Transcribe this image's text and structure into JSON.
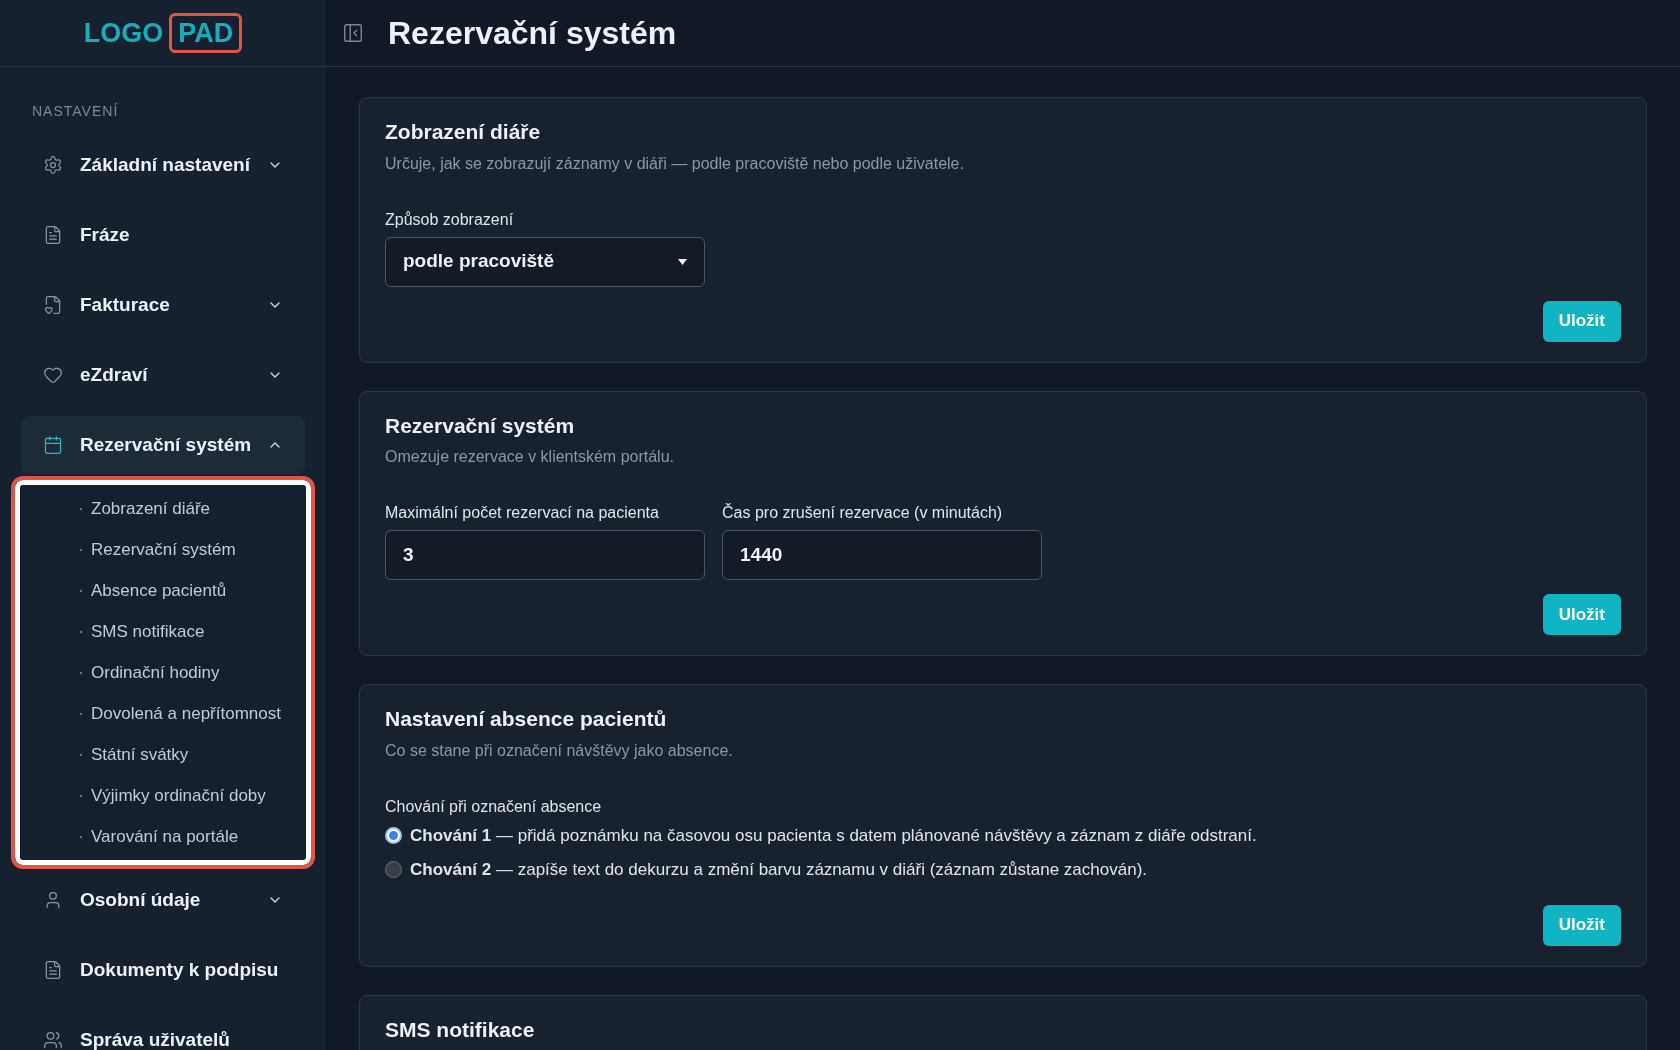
{
  "logo": {
    "word": "LOGO",
    "highlighted_word": "PAD"
  },
  "sidebar": {
    "section_title": "NASTAVENÍ",
    "items": [
      {
        "label": "Základní nastavení",
        "expandable": true,
        "expanded": false,
        "selected": false
      },
      {
        "label": "Fráze",
        "expandable": false,
        "selected": false
      },
      {
        "label": "Fakturace",
        "expandable": true,
        "expanded": false,
        "selected": false
      },
      {
        "label": "eZdraví",
        "expandable": true,
        "expanded": false,
        "selected": false
      },
      {
        "label": "Rezervační systém",
        "expandable": true,
        "expanded": true,
        "selected": true,
        "children": [
          {
            "label": "Zobrazení diáře"
          },
          {
            "label": "Rezervační systém"
          },
          {
            "label": "Absence pacientů"
          },
          {
            "label": "SMS notifikace"
          },
          {
            "label": "Ordinační hodiny"
          },
          {
            "label": "Dovolená a nepřítomnost"
          },
          {
            "label": "Státní svátky"
          },
          {
            "label": "Výjimky ordinační doby"
          },
          {
            "label": "Varování na portále"
          }
        ]
      },
      {
        "label": "Osobní údaje",
        "expandable": true,
        "expanded": false,
        "selected": false
      },
      {
        "label": "Dokumenty k podpisu",
        "expandable": false,
        "selected": false
      },
      {
        "label": "Správa uživatelů",
        "expandable": false,
        "selected": false
      }
    ]
  },
  "page_title": "Rezervační systém",
  "cards": [
    {
      "title": "Zobrazení diáře",
      "description": "Určuje, jak se zobrazují záznamy v diáři — podle pracoviště nebo podle uživatele.",
      "fields": [
        {
          "kind": "select",
          "label": "Způsob zobrazení",
          "value": "podle pracoviště"
        }
      ],
      "button": "Uložit"
    },
    {
      "title": "Rezervační systém",
      "description": "Omezuje rezervace v klientském portálu.",
      "fields": [
        {
          "kind": "input",
          "label": "Maximální počet rezervací na pacienta",
          "value": "3"
        },
        {
          "kind": "input",
          "label": "Čas pro zrušení rezervace (v minutách)",
          "value": "1440"
        }
      ],
      "button": "Uložit"
    },
    {
      "title": "Nastavení absence pacientů",
      "description": "Co se stane při označení návštěvy jako absence.",
      "fields": [
        {
          "kind": "radio",
          "label": "Chování při označení absence",
          "options": [
            {
              "text": "**Chování 1** — přidá poznámku na časovou osu pacienta s datem plánované návštěvy a záznam z diáře odstraní.",
              "selected": true
            },
            {
              "text": "**Chování 2** — zapíše text do dekurzu a změní barvu záznamu v diáři (záznam zůstane zachován).",
              "selected": false
            }
          ]
        }
      ],
      "button": "Uložit"
    },
    {
      "title": "SMS notifikace"
    }
  ]
}
